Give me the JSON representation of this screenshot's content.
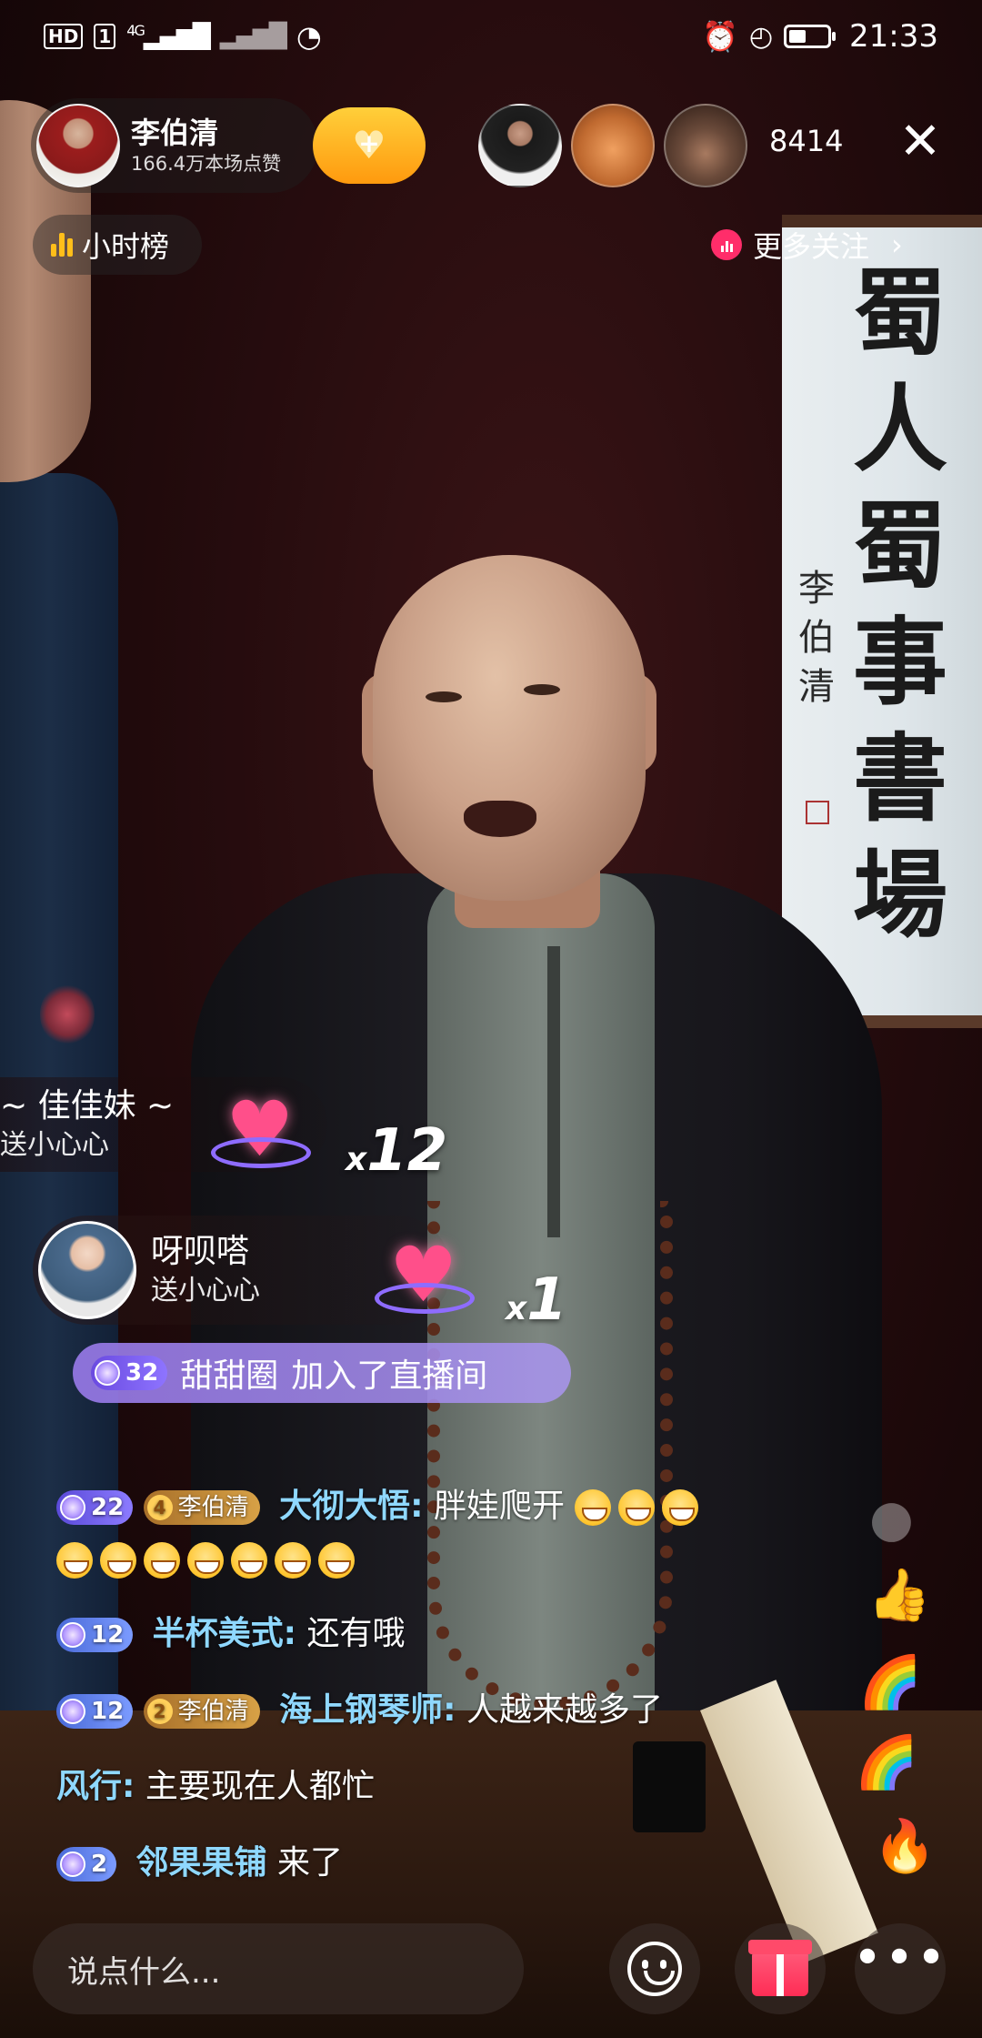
{
  "status_bar": {
    "hd": "HD",
    "sim": "1",
    "network": "4G",
    "time": "21:33",
    "icons": [
      "hd-icon",
      "signal-icon",
      "no-signal-icon",
      "wifi-icon",
      "alarm-icon",
      "speed-icon",
      "battery-icon"
    ]
  },
  "host": {
    "name": "李伯清",
    "likes": "166.4万本场点赞"
  },
  "top": {
    "viewer_count": "8414",
    "close": "✕",
    "rank_label": "小时榜",
    "more_follow": "更多关注",
    "more_follow_chevron": "›"
  },
  "calligraphy": {
    "main": "蜀人蜀事書場",
    "signature": "李伯清"
  },
  "gifts": [
    {
      "user": "~ 佳佳妹 ~",
      "action": "送小心心",
      "count_x": "x",
      "count": "12"
    },
    {
      "user": "呀呗嗒",
      "action": "送小心心",
      "count_x": "x",
      "count": "1"
    }
  ],
  "join": {
    "level": "32",
    "user": "甜甜圈",
    "text": "加入了直播间"
  },
  "chat": [
    {
      "level": "22",
      "fan_level": "4",
      "fan_club": "李伯清",
      "user": "大彻大悟:",
      "message": "胖娃爬开"
    },
    {
      "level": "12",
      "user": "半杯美式:",
      "message": "还有哦"
    },
    {
      "level": "12",
      "fan_level": "2",
      "fan_club": "李伯清",
      "user": "海上钢琴师:",
      "message": "人越来越多了"
    },
    {
      "user": "风行:",
      "message": "主要现在人都忙"
    },
    {
      "level": "2",
      "user": "邻果果铺",
      "message": "来了"
    }
  ],
  "bottom": {
    "input_placeholder": "说点什么...",
    "more": "•••"
  },
  "colors": {
    "follow_button": "#ffa31a",
    "join_bar": "#9f85e8",
    "username": "#8fd8ff",
    "gift_button": "#ff2d55"
  }
}
